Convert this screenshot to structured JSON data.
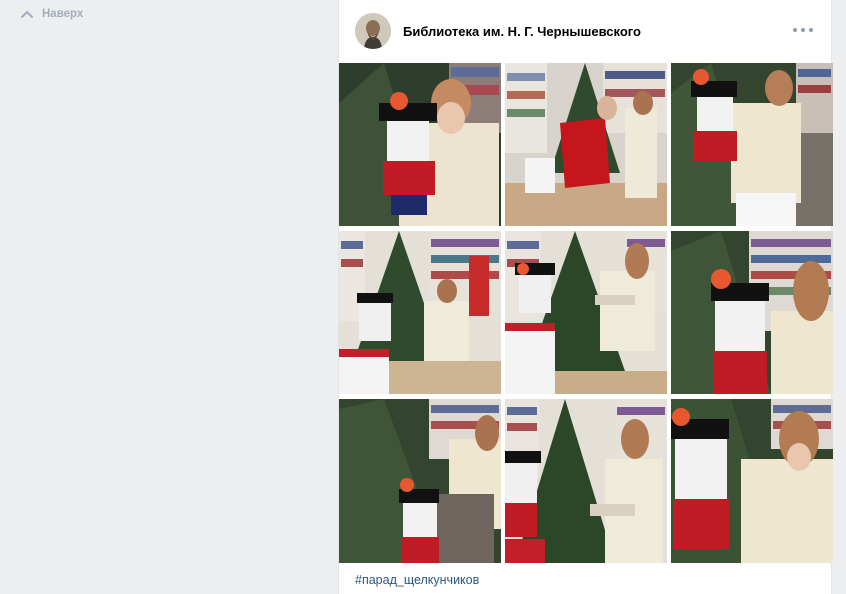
{
  "nav": {
    "up_label": "Наверх"
  },
  "post": {
    "author": "Библиотека им. Н. Г. Чернышевского",
    "photo_count": 9,
    "photos": [
      {
        "name": "photo-1",
        "alt": "nutcracker-hug"
      },
      {
        "name": "photo-2",
        "alt": "two-girls-by-tree"
      },
      {
        "name": "photo-3",
        "alt": "nutcracker-chair"
      },
      {
        "name": "photo-4",
        "alt": "reading-girl-wide"
      },
      {
        "name": "photo-5",
        "alt": "reading-girl-mid"
      },
      {
        "name": "photo-6",
        "alt": "girl-with-nutcracker"
      },
      {
        "name": "photo-7",
        "alt": "nutcracker-on-chair"
      },
      {
        "name": "photo-8",
        "alt": "reading-girl-close"
      },
      {
        "name": "photo-9",
        "alt": "girl-holding-nutcracker"
      }
    ],
    "hashtag": "#парад_щелкунчиков"
  },
  "colors": {
    "background": "#edeef0",
    "link": "#2a5885",
    "muted": "#a3adba"
  }
}
